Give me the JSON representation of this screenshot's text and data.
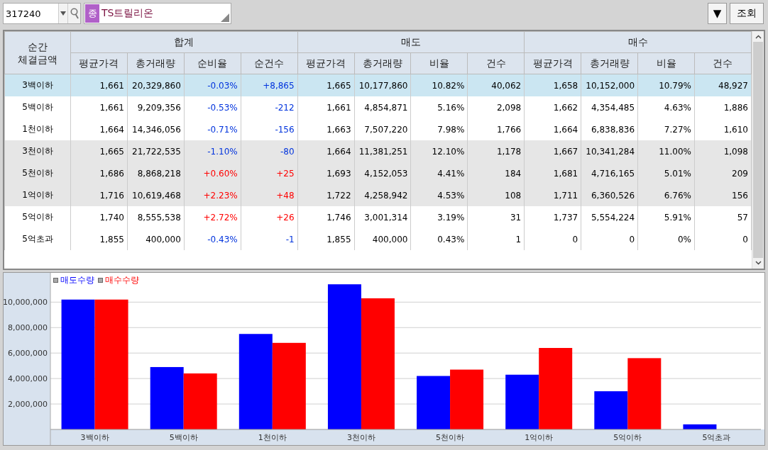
{
  "toolbar": {
    "code": "317240",
    "market_badge": "종",
    "name": "TS트릴리온",
    "menu_button": "▼",
    "query_button": "조회"
  },
  "table": {
    "corner_lines": [
      "순간",
      "체결금액"
    ],
    "groups": [
      {
        "label": "합계",
        "columns": [
          "평균가격",
          "총거래량",
          "순비율",
          "순건수"
        ]
      },
      {
        "label": "매도",
        "columns": [
          "평균가격",
          "총거래량",
          "비율",
          "건수"
        ]
      },
      {
        "label": "매수",
        "columns": [
          "평균가격",
          "총거래량",
          "비율",
          "건수"
        ]
      }
    ],
    "rows": [
      {
        "label": "3백이하",
        "selected": true,
        "rising": false,
        "cells": [
          "1,661",
          "20,329,860",
          "-0.03%",
          "+8,865",
          "1,665",
          "10,177,860",
          "10.82%",
          "40,062",
          "1,658",
          "10,152,000",
          "10.79%",
          "48,927"
        ]
      },
      {
        "label": "5백이하",
        "selected": false,
        "rising": false,
        "cells": [
          "1,661",
          "9,209,356",
          "-0.53%",
          "-212",
          "1,661",
          "4,854,871",
          "5.16%",
          "2,098",
          "1,662",
          "4,354,485",
          "4.63%",
          "1,886"
        ]
      },
      {
        "label": "1천이하",
        "selected": false,
        "rising": false,
        "cells": [
          "1,664",
          "14,346,056",
          "-0.71%",
          "-156",
          "1,663",
          "7,507,220",
          "7.98%",
          "1,766",
          "1,664",
          "6,838,836",
          "7.27%",
          "1,610"
        ]
      },
      {
        "label": "3천이하",
        "selected": false,
        "rising": false,
        "cells": [
          "1,665",
          "21,722,535",
          "-1.10%",
          "-80",
          "1,664",
          "11,381,251",
          "12.10%",
          "1,178",
          "1,667",
          "10,341,284",
          "11.00%",
          "1,098"
        ]
      },
      {
        "label": "5천이하",
        "selected": false,
        "rising": true,
        "cells": [
          "1,686",
          "8,868,218",
          "+0.60%",
          "+25",
          "1,693",
          "4,152,053",
          "4.41%",
          "184",
          "1,681",
          "4,716,165",
          "5.01%",
          "209"
        ]
      },
      {
        "label": "1억이하",
        "selected": false,
        "rising": true,
        "cells": [
          "1,716",
          "10,619,468",
          "+2.23%",
          "+48",
          "1,722",
          "4,258,942",
          "4.53%",
          "108",
          "1,711",
          "6,360,526",
          "6.76%",
          "156"
        ]
      },
      {
        "label": "5억이하",
        "selected": false,
        "rising": true,
        "cells": [
          "1,740",
          "8,555,538",
          "+2.72%",
          "+26",
          "1,746",
          "3,001,314",
          "3.19%",
          "31",
          "1,737",
          "5,554,224",
          "5.91%",
          "57"
        ]
      },
      {
        "label": "5억초과",
        "selected": false,
        "rising": false,
        "cells": [
          "1,855",
          "400,000",
          "-0.43%",
          "-1",
          "1,855",
          "400,000",
          "0.43%",
          "1",
          "0",
          "0",
          "0%",
          "0"
        ]
      }
    ]
  },
  "chart": {
    "chart_data": {
      "type": "bar",
      "categories": [
        "3백이하",
        "5백이하",
        "1천이하",
        "3천이하",
        "5천이하",
        "1억이하",
        "5억이하",
        "5억초과"
      ],
      "series": [
        {
          "name": "매도수량",
          "color": "#0000ff",
          "values": [
            10200000,
            4900000,
            7500000,
            11400000,
            4200000,
            4300000,
            3000000,
            400000
          ]
        },
        {
          "name": "매수수량",
          "color": "#ff0000",
          "values": [
            10200000,
            4400000,
            6800000,
            10300000,
            4700000,
            6400000,
            5600000,
            0
          ]
        }
      ],
      "ylim": [
        0,
        12300000
      ],
      "grid": true,
      "yticks": [
        {
          "value": 2000000,
          "label": "2,000,000"
        },
        {
          "value": 4000000,
          "label": "4,000,000"
        },
        {
          "value": 6000000,
          "label": "6,000,000"
        },
        {
          "value": 8000000,
          "label": "8,000,000"
        },
        {
          "value": 10000000,
          "label": "10,000,000"
        }
      ]
    }
  }
}
